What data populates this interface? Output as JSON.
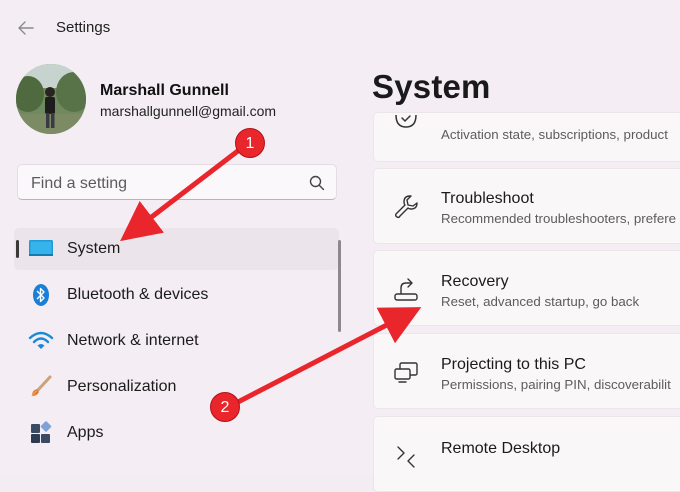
{
  "titlebar": {
    "title": "Settings",
    "back_icon": "arrow-left-icon"
  },
  "profile": {
    "name": "Marshall Gunnell",
    "email": "marshallgunnell@gmail.com"
  },
  "search": {
    "placeholder": "Find a setting",
    "value": ""
  },
  "nav": {
    "items": [
      {
        "label": "System",
        "icon": "monitor-icon",
        "selected": true
      },
      {
        "label": "Bluetooth & devices",
        "icon": "bluetooth-icon",
        "selected": false
      },
      {
        "label": "Network & internet",
        "icon": "wifi-icon",
        "selected": false
      },
      {
        "label": "Personalization",
        "icon": "paintbrush-icon",
        "selected": false
      },
      {
        "label": "Apps",
        "icon": "apps-icon",
        "selected": false
      }
    ]
  },
  "main": {
    "heading": "System",
    "cards": [
      {
        "title": "",
        "subtitle": "Activation state, subscriptions, product",
        "icon": "activation-icon"
      },
      {
        "title": "Troubleshoot",
        "subtitle": "Recommended troubleshooters, prefere",
        "icon": "wrench-icon"
      },
      {
        "title": "Recovery",
        "subtitle": "Reset, advanced startup, go back",
        "icon": "recovery-icon"
      },
      {
        "title": "Projecting to this PC",
        "subtitle": "Permissions, pairing PIN, discoverabilit",
        "icon": "projecting-icon"
      },
      {
        "title": "Remote Desktop",
        "subtitle": "",
        "icon": "remote-desktop-icon"
      }
    ]
  },
  "annotations": {
    "callouts": [
      {
        "label": "1"
      },
      {
        "label": "2"
      }
    ],
    "color": "#e8262b"
  },
  "colors": {
    "accent": "#0f6cbd",
    "annotation": "#e8262b",
    "background": "#f4edf3"
  }
}
